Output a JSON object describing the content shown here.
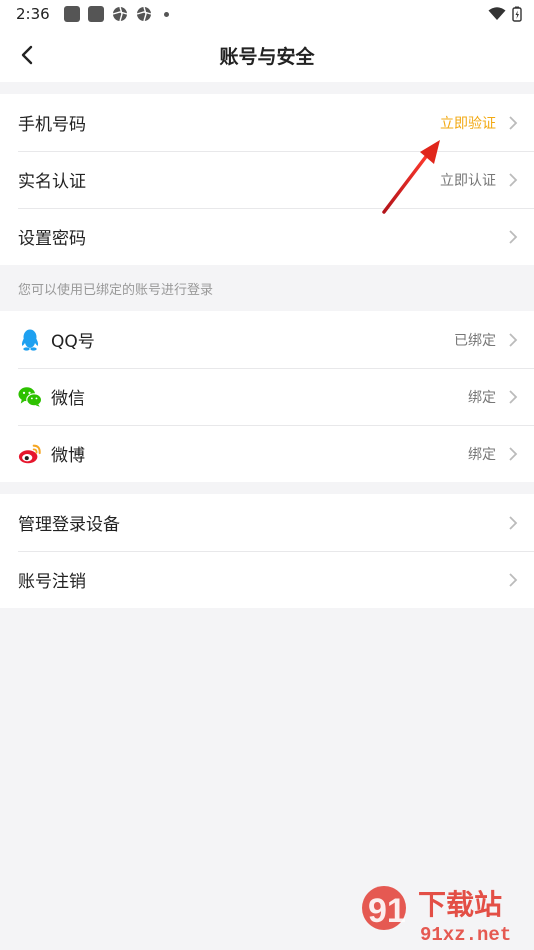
{
  "status_bar": {
    "time": "2:36"
  },
  "header": {
    "title": "账号与安全"
  },
  "account_rows": [
    {
      "label": "手机号码",
      "value": "立即验证"
    },
    {
      "label": "实名认证",
      "value": "立即认证"
    },
    {
      "label": "设置密码",
      "value": ""
    }
  ],
  "social_section": {
    "hint": "您可以使用已绑定的账号进行登录"
  },
  "social_rows": [
    {
      "label": "QQ号",
      "value": "已绑定",
      "icon": "qq-icon"
    },
    {
      "label": "微信",
      "value": "绑定",
      "icon": "wechat-icon"
    },
    {
      "label": "微博",
      "value": "绑定",
      "icon": "weibo-icon"
    }
  ],
  "manage_rows": [
    {
      "label": "管理登录设备"
    },
    {
      "label": "账号注销"
    }
  ],
  "watermark": {
    "number": "91",
    "site_cn": "下载站",
    "site_url": "91xz.net"
  },
  "colors": {
    "accent": "#f2a913",
    "annotation_arrow": "#e0261b",
    "qq": "#1ea0f0",
    "wechat": "#2dc100",
    "weibo": "#e6162d"
  }
}
